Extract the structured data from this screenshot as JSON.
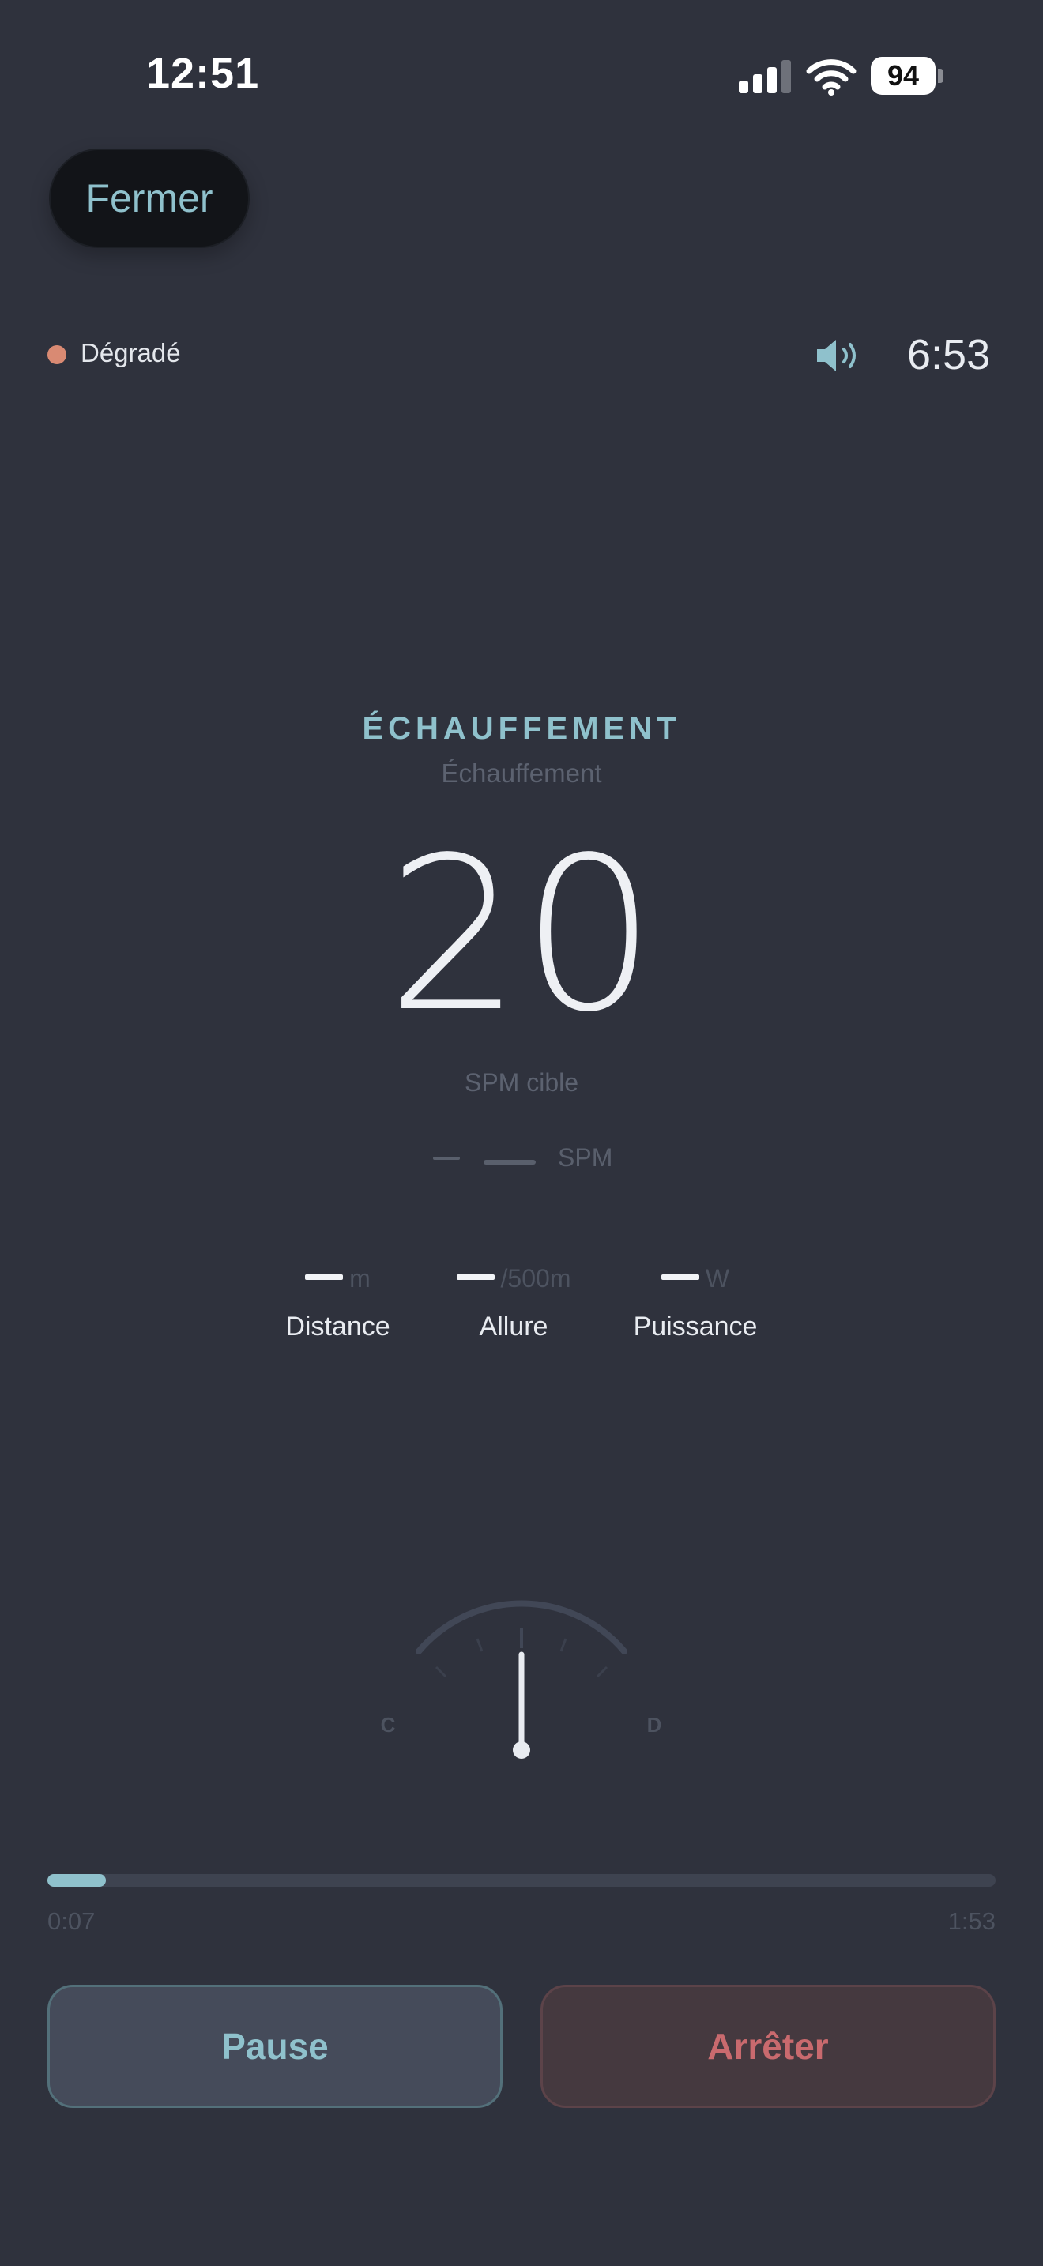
{
  "status_bar": {
    "time": "12:51",
    "battery": "94",
    "icons": [
      "cellular-signal-icon",
      "wifi-icon",
      "battery-icon"
    ]
  },
  "header": {
    "close_label": "Fermer",
    "connection_status": "Dégradé",
    "connection_status_color": "#d98a73",
    "sound_icon": "speaker-icon",
    "remaining_time": "6:53"
  },
  "phase": {
    "title": "ÉCHAUFFEMENT",
    "subtitle": "Échauffement"
  },
  "spm": {
    "target_value": "20",
    "target_label": "SPM cible",
    "current_unit": "SPM"
  },
  "metrics": [
    {
      "label": "Distance",
      "unit": "m"
    },
    {
      "label": "Allure",
      "unit": "/500m"
    },
    {
      "label": "Puissance",
      "unit": "W"
    }
  ],
  "gauge": {
    "left_label": "C",
    "right_label": "D"
  },
  "progress": {
    "elapsed": "0:07",
    "total": "1:53",
    "fraction": 0.062
  },
  "actions": {
    "pause_label": "Pause",
    "stop_label": "Arrêter"
  },
  "colors": {
    "background": "#2f323d",
    "accent": "#8fc1cc",
    "danger": "#c96a6e"
  }
}
